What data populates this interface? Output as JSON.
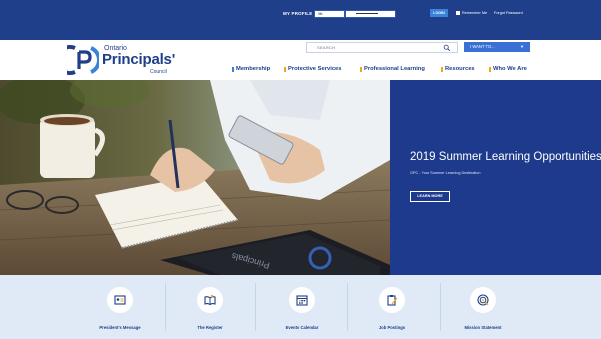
{
  "topbar": {
    "profile_label": "MY PROFILE",
    "username_value": "ittb",
    "login_label": "LOGIN",
    "remember_label": "Remember Me",
    "forgot_label": "Forgot Password"
  },
  "logo": {
    "line1": "Ontario",
    "line2": "Principals'",
    "line3": "Council"
  },
  "search": {
    "placeholder": "SEARCH"
  },
  "iwant": {
    "label": "I WANT TO..."
  },
  "nav": {
    "items": [
      {
        "label": "Membership"
      },
      {
        "label": "Protective Services"
      },
      {
        "label": "Professional Learning"
      },
      {
        "label": "Resources"
      },
      {
        "label": "Who We Are"
      }
    ]
  },
  "hero": {
    "title": "2019 Summer Learning Opportunities",
    "subtitle": "OPC - Your Summer Learning Destination",
    "button": "LEARN MORE",
    "tablet_text": "Principals"
  },
  "quick_links": [
    {
      "label": "President's Message",
      "icon": "id-card-icon"
    },
    {
      "label": "The Register",
      "icon": "open-book-icon"
    },
    {
      "label": "Events Calendar",
      "icon": "calendar-icon"
    },
    {
      "label": "Job Postings",
      "icon": "clipboard-pen-icon"
    },
    {
      "label": "Mission Statement",
      "icon": "target-icon"
    }
  ],
  "colors": {
    "brand_blue": "#1f3f8a",
    "accent_orange": "#f2a51f",
    "accent_blue": "#3a6fd6",
    "quick_bg": "#dfeaf6"
  }
}
